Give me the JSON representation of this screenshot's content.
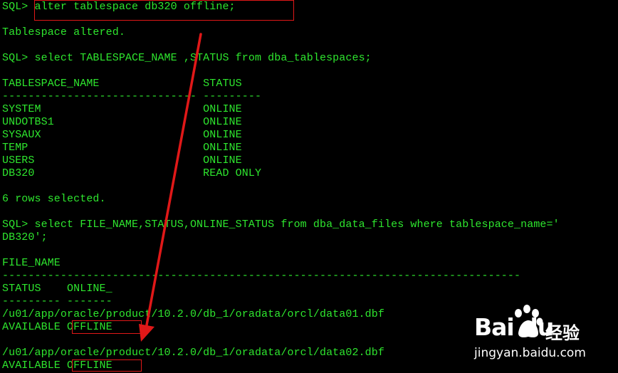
{
  "terminal": {
    "lines": [
      "SQL> alter tablespace db320 offline;",
      "",
      "Tablespace altered.",
      "",
      "SQL> select TABLESPACE_NAME ,STATUS from dba_tablespaces;",
      "",
      "TABLESPACE_NAME                STATUS",
      "------------------------------ ---------",
      "SYSTEM                         ONLINE",
      "UNDOTBS1                       ONLINE",
      "SYSAUX                         ONLINE",
      "TEMP                           ONLINE",
      "USERS                          ONLINE",
      "DB320                          READ ONLY",
      "",
      "6 rows selected.",
      "",
      "SQL> select FILE_NAME,STATUS,ONLINE_STATUS from dba_data_files where tablespace_name='",
      "DB320';",
      "",
      "FILE_NAME",
      "--------------------------------------------------------------------------------",
      "STATUS    ONLINE_",
      "--------- -------",
      "/u01/app/oracle/product/10.2.0/db_1/oradata/orcl/data01.dbf",
      "AVAILABLE OFFLINE",
      "",
      "/u01/app/oracle/product/10.2.0/db_1/oradata/orcl/data02.dbf",
      "AVAILABLE OFFLINE"
    ]
  },
  "colors": {
    "background": "#000000",
    "text": "#2ee62e",
    "annotation": "#e01818",
    "watermark": "#ffffff"
  },
  "watermark": {
    "brand": "Bai du",
    "product": "经验",
    "url": "jingyan.baidu.com",
    "icon": "baidu-paw-icon"
  }
}
